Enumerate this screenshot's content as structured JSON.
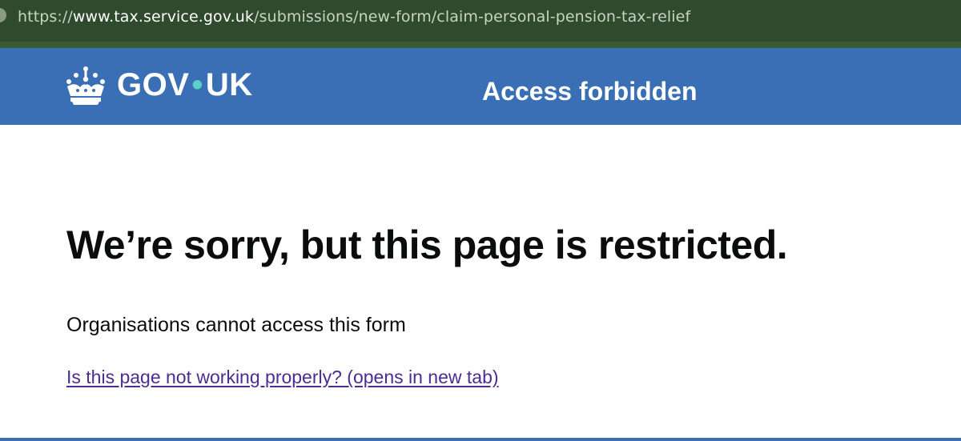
{
  "browser": {
    "url_scheme": "https://",
    "url_host": "www.tax.service.gov.uk",
    "url_path": "/submissions/new-form/claim-personal-pension-tax-relief"
  },
  "header": {
    "logo_left": "GOV",
    "logo_dot": "•",
    "logo_right": "UK",
    "service_title": "Access forbidden",
    "background_color": "#3b6fb5",
    "dot_color": "#5ad1c8"
  },
  "main": {
    "heading": "We’re sorry, but this page is restricted.",
    "body": "Organisations cannot access this form",
    "help_link": "Is this page not working properly? (opens in new tab)",
    "link_color": "#4c2c92"
  },
  "icons": {
    "logo": "crown-icon"
  }
}
